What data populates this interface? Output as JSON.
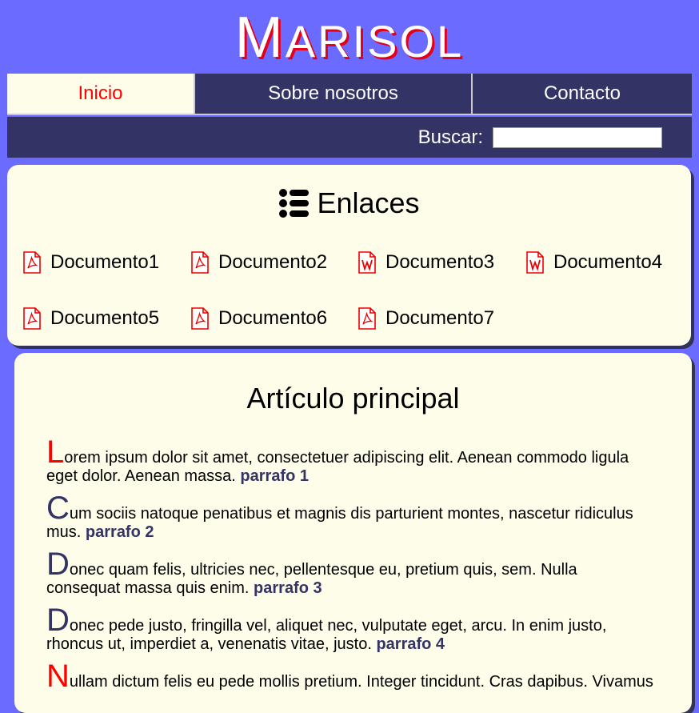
{
  "header": {
    "title_first": "M",
    "title_rest": "ARISOL"
  },
  "nav": {
    "tabs": [
      {
        "label": "Inicio"
      },
      {
        "label": "Sobre nosotros"
      },
      {
        "label": "Contacto"
      }
    ]
  },
  "search": {
    "label": "Buscar:",
    "value": ""
  },
  "links": {
    "heading": "Enlaces",
    "heading_icon": "list-icon",
    "documents": [
      {
        "label": "Documento1",
        "icon": "pdf-file-icon"
      },
      {
        "label": "Documento2",
        "icon": "pdf-file-icon"
      },
      {
        "label": "Documento3",
        "icon": "word-file-icon"
      },
      {
        "label": "Documento4",
        "icon": "word-file-icon"
      },
      {
        "label": "Documento5",
        "icon": "pdf-file-icon"
      },
      {
        "label": "Documento6",
        "icon": "pdf-file-icon"
      },
      {
        "label": "Documento7",
        "icon": "pdf-file-icon"
      }
    ]
  },
  "article": {
    "title": "Artículo principal",
    "paragraphs": [
      {
        "initial": "L",
        "text": "orem ipsum dolor sit amet, consectetuer adipiscing elit. Aenean commodo ligula eget dolor. Aenean massa. ",
        "tag": "parrafo 1"
      },
      {
        "initial": "C",
        "text": "um sociis natoque penatibus et magnis dis parturient montes, nascetur ridiculus mus. ",
        "tag": "parrafo 2"
      },
      {
        "initial": "D",
        "text": "onec quam felis, ultricies nec, pellentesque eu, pretium quis, sem. Nulla consequat massa quis enim. ",
        "tag": "parrafo 3"
      },
      {
        "initial": "D",
        "text": "onec pede justo, fringilla vel, aliquet nec, vulputate eget, arcu. In enim justo, rhoncus ut, imperdiet a, venenatis vitae, justo. ",
        "tag": "parrafo 4"
      },
      {
        "initial": "N",
        "text": "ullam dictum felis eu pede mollis pretium. Integer tincidunt. Cras dapibus. Vivamus",
        "tag": ""
      }
    ]
  },
  "colors": {
    "background": "#6b6bff",
    "nav_dark": "#333366",
    "card": "#fdfdea",
    "accent_red": "#ff0000"
  }
}
